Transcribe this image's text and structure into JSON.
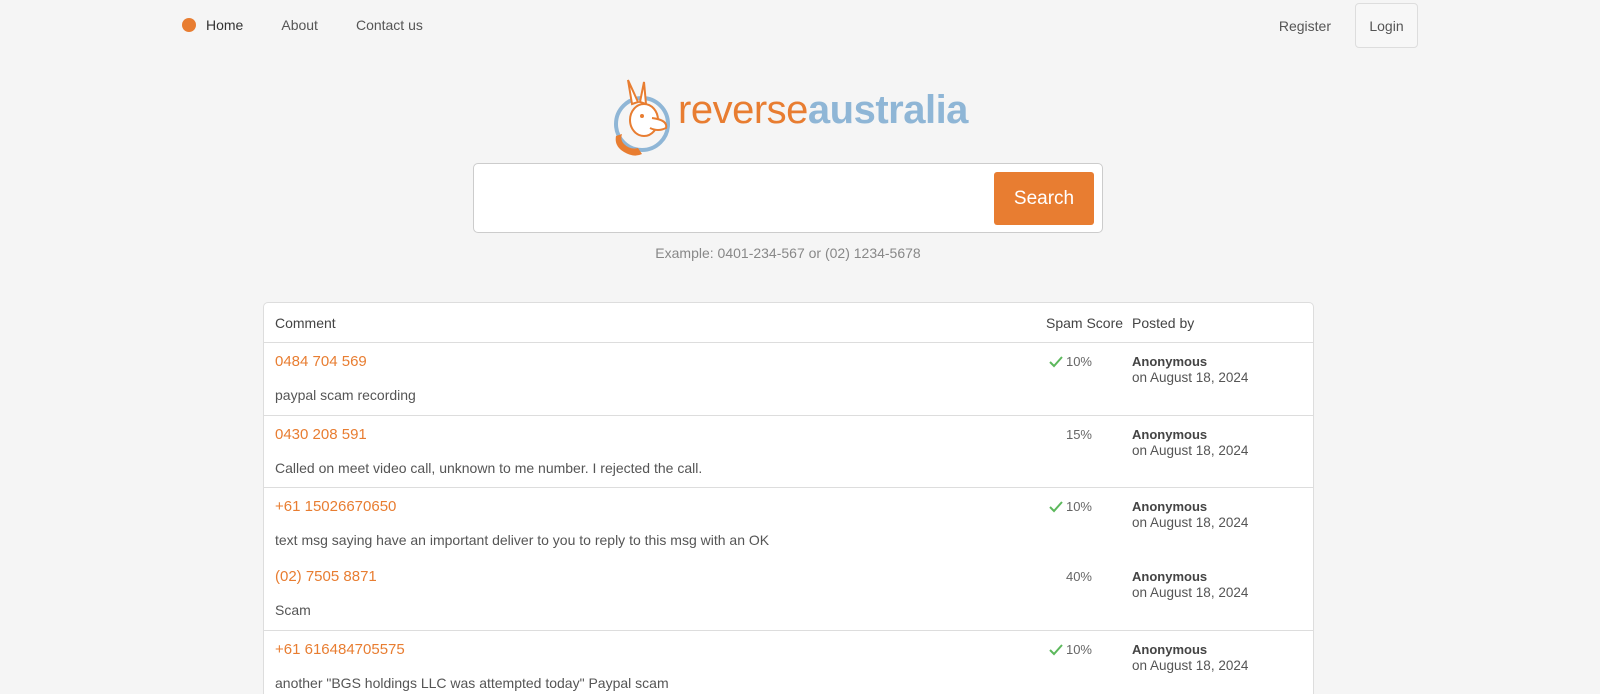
{
  "nav": {
    "home": "Home",
    "about": "About",
    "contact": "Contact us",
    "register": "Register",
    "login": "Login",
    "accent": "#e87d31"
  },
  "logo": {
    "part1": "reverse",
    "part2": "australia"
  },
  "search": {
    "value": "",
    "placeholder": "",
    "button": "Search",
    "example": "Example: 0401-234-567 or (02) 1234-5678"
  },
  "table": {
    "headers": {
      "comment": "Comment",
      "spam": "Spam Score",
      "posted": "Posted by"
    },
    "rows": [
      {
        "phone": "0484 704 569",
        "comment": "paypal scam recording",
        "score": "10%",
        "check": true,
        "poster": "Anonymous",
        "date": "on August 18, 2024"
      },
      {
        "phone": "0430 208 591",
        "comment": "Called on meet video call, unknown to me number. I rejected the call.",
        "score": "15%",
        "check": false,
        "poster": "Anonymous",
        "date": "on August 18, 2024"
      },
      {
        "phone": "+61 15026670650",
        "comment": "text msg saying have an important deliver to you to reply to this msg with an OK",
        "score": "10%",
        "check": true,
        "poster": "Anonymous",
        "date": "on August 18, 2024"
      },
      {
        "phone": "(02) 7505 8871",
        "comment": "Scam",
        "score": "40%",
        "check": false,
        "poster": "Anonymous",
        "date": "on August 18, 2024"
      },
      {
        "phone": "+61 616484705575",
        "comment": "another \"BGS holdings LLC was attempted today\" Paypal scam",
        "score": "10%",
        "check": true,
        "poster": "Anonymous",
        "date": "on August 18, 2024"
      }
    ]
  }
}
